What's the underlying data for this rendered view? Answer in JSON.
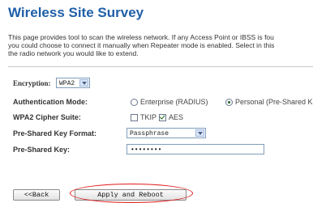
{
  "page": {
    "title": "Wireless Site Survey",
    "description": [
      "This page provides tool to scan the wireless network. If any Access Point or IBSS is fou",
      "you could choose to connect it manually when Repeater mode is enabled. Select in this",
      "the radio network you would like to extend."
    ]
  },
  "form": {
    "encryption": {
      "label": "Encryption:",
      "value": "WPA2"
    },
    "auth_mode": {
      "label": "Authentication Mode:",
      "options": [
        {
          "label": "Enterprise (RADIUS)",
          "selected": false
        },
        {
          "label": "Personal (Pre-Shared Ke",
          "selected": true
        }
      ]
    },
    "cipher_suite": {
      "label": "WPA2 Cipher Suite:",
      "options": [
        {
          "label": "TKIP",
          "checked": false
        },
        {
          "label": "AES",
          "checked": true
        }
      ]
    },
    "psk_format": {
      "label": "Pre-Shared Key Format:",
      "value": "Passphrase"
    },
    "psk": {
      "label": "Pre-Shared Key:",
      "value": "••••••••"
    }
  },
  "buttons": {
    "back": "<<Back",
    "apply": "Apply and Reboot"
  },
  "colors": {
    "title": "#1f5fa8",
    "annotation_circle": "#e01818"
  }
}
